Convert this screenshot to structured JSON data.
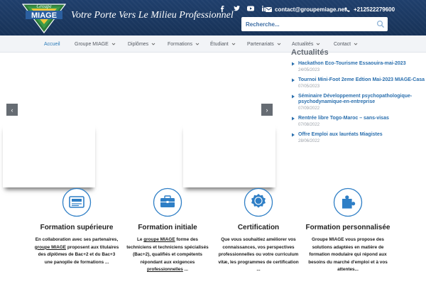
{
  "header": {
    "logo_text_top": "Groupe",
    "logo_text_main": "MIAGE",
    "tagline": "Votre Porte Vers Le Milieu Professionnel",
    "email": "contact@groupemiage.net",
    "phone": "+212522279600",
    "social_icons": [
      "facebook-icon",
      "twitter-icon",
      "youtube-icon",
      "linkedin-icon"
    ],
    "search_placeholder": "Recherche..."
  },
  "nav": {
    "items": [
      {
        "label": "Accueil",
        "has_dropdown": false,
        "active": true
      },
      {
        "label": "Groupe MIAGE",
        "has_dropdown": true
      },
      {
        "label": "Diplômes",
        "has_dropdown": true
      },
      {
        "label": "Formations",
        "has_dropdown": true
      },
      {
        "label": "Étudiant",
        "has_dropdown": true
      },
      {
        "label": "Partenariats",
        "has_dropdown": true
      },
      {
        "label": "Actualités",
        "has_dropdown": true
      },
      {
        "label": "Contact",
        "has_dropdown": true
      }
    ]
  },
  "slider": {
    "prev": "‹",
    "next": "›"
  },
  "news": {
    "title": "Actualités",
    "items": [
      {
        "title": "Hackathon Eco-Tourisme Essaouira-mai-2023",
        "date": "24/05/2023"
      },
      {
        "title": "Tournoi Mini-Foot 2eme Edtion Mai-2023 MIAGE-Casa",
        "date": "07/05/2023"
      },
      {
        "title": "Séminaire Développement psychopathologique-psychodynamique-en-entreprise",
        "date": "07/09/2022"
      },
      {
        "title": "Rentrée libre Togo-Maroc – sans-visas",
        "date": "07/08/2022"
      },
      {
        "title": "Offre Emploi aux lauréats Miagistes",
        "date": "28/06/2022"
      }
    ]
  },
  "features": [
    {
      "icon": "graduation-icon",
      "title": "Formation supérieure",
      "desc": [
        {
          "t": "En collaboration avec ses partenaires, "
        },
        {
          "t": "groupe MIAGE",
          "u": true
        },
        {
          "t": " proposent aux titulaires des "
        },
        {
          "t": "diplômes",
          "i": true
        },
        {
          "t": " de Bac+2 et du Bac+3 une panoplie de formations ..."
        }
      ]
    },
    {
      "icon": "briefcase-icon",
      "title": "Formation initiale",
      "desc": [
        {
          "t": "Le "
        },
        {
          "t": "groupe MIAGE",
          "u": true
        },
        {
          "t": " forme des techniciens et techniciens spécialisés (Bac+2), qualifiés et compétents répondant aux exigences "
        },
        {
          "t": "professionnelles",
          "u": true
        },
        {
          "t": " ..."
        }
      ]
    },
    {
      "icon": "certificate-icon",
      "title": "Certification",
      "desc": [
        {
          "t": "Que vous souhaitiez améliorer vos connaissances, vos perspectives professionnelles ou votre curriculum vitæ, les programmes de certification ..."
        }
      ]
    },
    {
      "icon": "puzzle-icon",
      "title": "Formation personnalisée",
      "desc": [
        {
          "t": "Groupe MIAGE vous propose des solutions adaptées en matière de formation modulaire qui répond aux besoins du marché d'emploi et à vos attentes..."
        }
      ]
    }
  ],
  "colors": {
    "header_bg": "#1f3f6c",
    "accent_blue": "#2a7ab8",
    "news_link": "#2a6fae",
    "icon_blue": "#2f7fc6"
  }
}
